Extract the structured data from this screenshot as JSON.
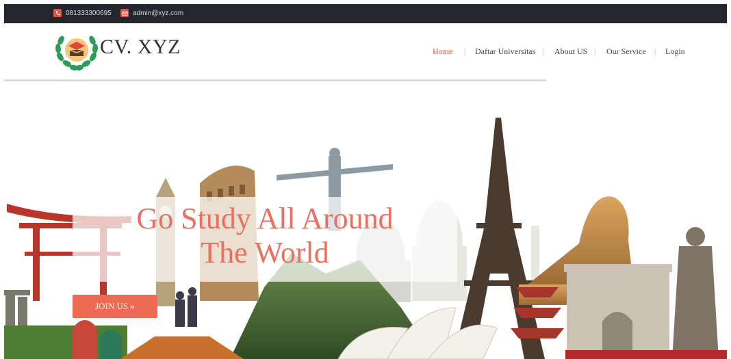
{
  "topbar": {
    "phone": "081333300695",
    "email": "admin@xyz.com"
  },
  "brand": {
    "name": "CV. XYZ"
  },
  "nav": {
    "items": [
      {
        "label": "Home",
        "active": true
      },
      {
        "label": "Daftar Universitas",
        "active": false
      },
      {
        "label": "About US",
        "active": false
      },
      {
        "label": "Our Service",
        "active": false
      },
      {
        "label": "Login",
        "active": false
      }
    ]
  },
  "hero": {
    "headline_line1": "Go Study All Around",
    "headline_line2": "The World",
    "cta_label": "JOIN US »"
  },
  "colors": {
    "accent": "#e8513f",
    "topbar_bg": "#23262c",
    "headline": "#ec6f5f"
  },
  "icons": [
    "phone-icon",
    "mail-icon",
    "laurel-book-logo-icon"
  ]
}
